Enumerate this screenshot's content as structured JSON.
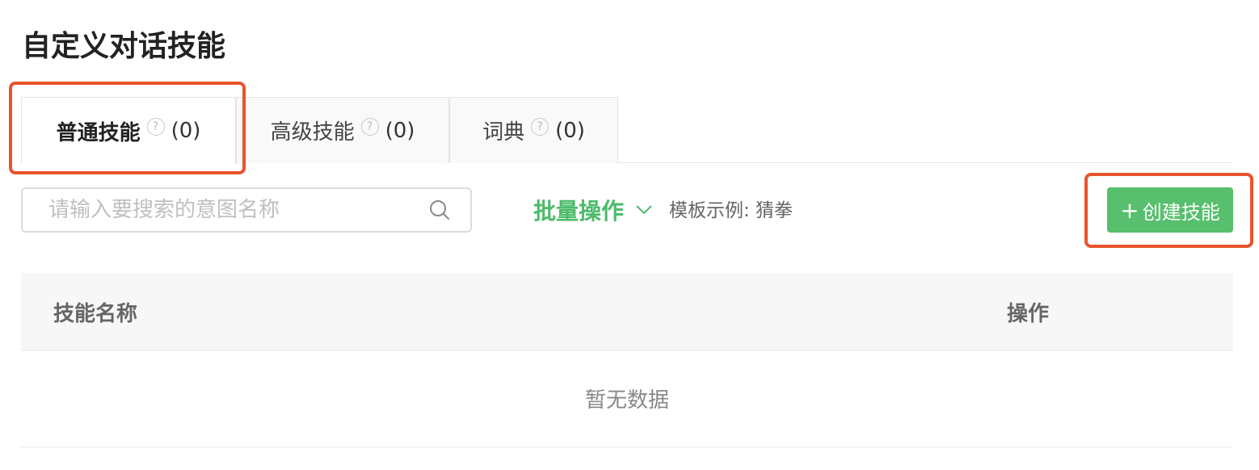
{
  "page": {
    "title": "自定义对话技能"
  },
  "tabs": [
    {
      "label": "普通技能",
      "count": "(0)",
      "help_icon": "?",
      "active": true
    },
    {
      "label": "高级技能",
      "count": "(0)",
      "help_icon": "?",
      "active": false
    },
    {
      "label": "词典",
      "count": "(0)",
      "help_icon": "?",
      "active": false
    }
  ],
  "toolbar": {
    "search_placeholder": "请输入要搜索的意图名称",
    "search_value": "",
    "batch_label": "批量操作",
    "template_example": "模板示例: 猜拳",
    "create_label": "创建技能",
    "create_icon": "+"
  },
  "table": {
    "columns": [
      "技能名称",
      "操作"
    ],
    "empty_text": "暂无数据"
  },
  "colors": {
    "accent_green": "#4cbb6a",
    "button_green": "#57bf6d",
    "highlight_orange": "#e8542c"
  },
  "icons": {
    "search": "search-icon",
    "chevron": "chevron-down-icon",
    "help": "question-circle-icon",
    "plus": "plus-icon"
  }
}
